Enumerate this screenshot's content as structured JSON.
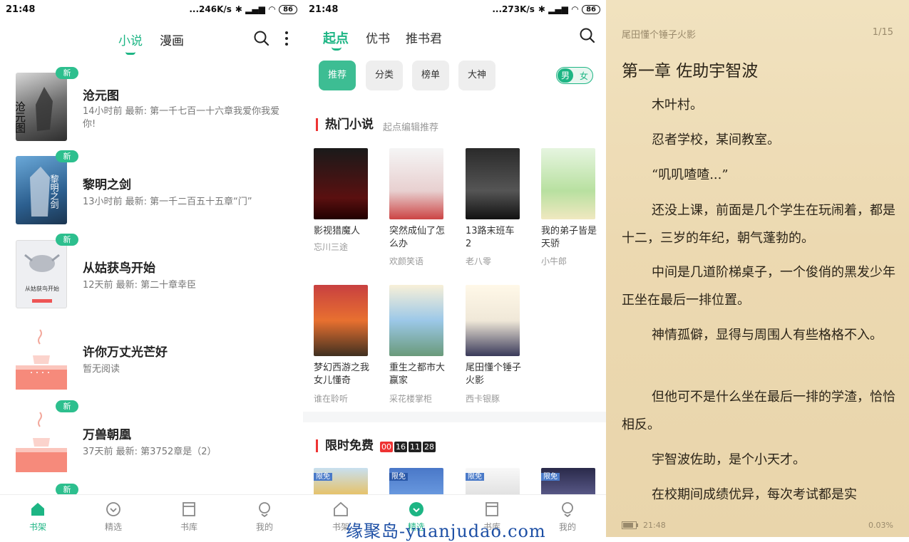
{
  "screen1": {
    "status": {
      "time": "21:48",
      "net": "...246K/s",
      "battery": "86"
    },
    "tabs": [
      "小说",
      "漫画"
    ],
    "books": [
      {
        "title": "沧元图",
        "sub": "14小时前 最新: 第一千七百一十六章我爱你我爱你!",
        "badge": "新",
        "cover_text": "沧元图"
      },
      {
        "title": "黎明之剑",
        "sub": "13小时前 最新: 第一千二百五十五章“门”",
        "badge": "新",
        "cover_text": "黎明之剑"
      },
      {
        "title": "从姑获鸟开始",
        "sub": "12天前 最新: 第二十章幸臣",
        "badge": "新",
        "cover_text": "从姑获鸟开始"
      },
      {
        "title": "许你万丈光芒好",
        "sub": "暂无阅读",
        "badge": "",
        "cover_text": ""
      },
      {
        "title": "万兽朝凰",
        "sub": "37天前 最新: 第3752章是（2）",
        "badge": "新",
        "cover_text": ""
      }
    ],
    "extra_badge": "新",
    "nav": [
      "书架",
      "精选",
      "书库",
      "我的"
    ]
  },
  "screen2": {
    "status": {
      "time": "21:48",
      "net": "...273K/s",
      "battery": "86"
    },
    "tabs": [
      "起点",
      "优书",
      "推书君"
    ],
    "chips": [
      "推荐",
      "分类",
      "榜单",
      "大神"
    ],
    "gender": {
      "male": "男",
      "female": "女"
    },
    "hot_title": "热门小说",
    "hot_sub": "起点编辑推荐",
    "books": [
      {
        "title": "影视猎魔人",
        "author": "忘川三途"
      },
      {
        "title": "突然成仙了怎么办",
        "author": "欢颜笑语"
      },
      {
        "title": "13路末班车2",
        "author": "老八零"
      },
      {
        "title": "我的弟子皆是天骄",
        "author": "小牛郎"
      },
      {
        "title": "梦幻西游之我女儿懂奇",
        "author": "谁在聆听"
      },
      {
        "title": "重生之都市大赢家",
        "author": "采花楼掌柜"
      },
      {
        "title": "尾田懂个锤子火影",
        "author": "西卡银豚"
      }
    ],
    "free_title": "限时免费",
    "timer": [
      "00",
      "16",
      "11",
      "28"
    ],
    "free_badge": "限免",
    "nav": [
      "书架",
      "精选",
      "书库",
      "我的"
    ]
  },
  "screen3": {
    "book": "尾田懂个锤子火影",
    "page": "1/15",
    "chapter": "第一章 佐助宇智波",
    "paragraphs": [
      "木叶村。",
      "忍者学校，某间教室。",
      "“叽叽喳喳...”",
      "还没上课，前面是几个学生在玩闹着，都是十二，三岁的年纪，朝气蓬勃的。",
      "中间是几道阶梯桌子，一个俊俏的黑发少年正坐在最后一排位置。",
      "神情孤僻，显得与周围人有些格格不入。",
      "但他可不是什么坐在最后一排的学渣，恰恰相反。",
      "宇智波佐助，是个小天才。",
      "在校期间成绩优异，每次考试都是实"
    ],
    "time": "21:48",
    "progress": "0.03%"
  },
  "watermark": "缘聚岛-yuanjudao.com",
  "colors": {
    "accent": "#1db584",
    "red": "#e33333"
  }
}
